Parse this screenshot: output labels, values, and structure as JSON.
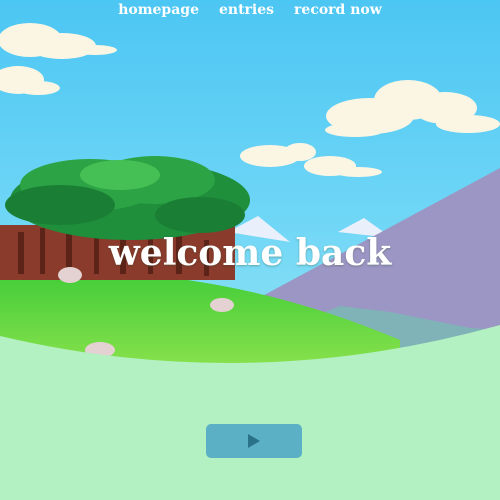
{
  "nav": {
    "items": [
      {
        "label": "homepage"
      },
      {
        "label": "entries"
      },
      {
        "label": "record now"
      }
    ]
  },
  "hero": {
    "title": "welcome back"
  },
  "play_button": {
    "icon": "play-icon"
  },
  "colors": {
    "sky": "#5ccdf2",
    "ground": "#b3f0c2",
    "button": "#5bb0c6",
    "button_icon": "#2a7288",
    "mountain": "#9b96c4"
  }
}
